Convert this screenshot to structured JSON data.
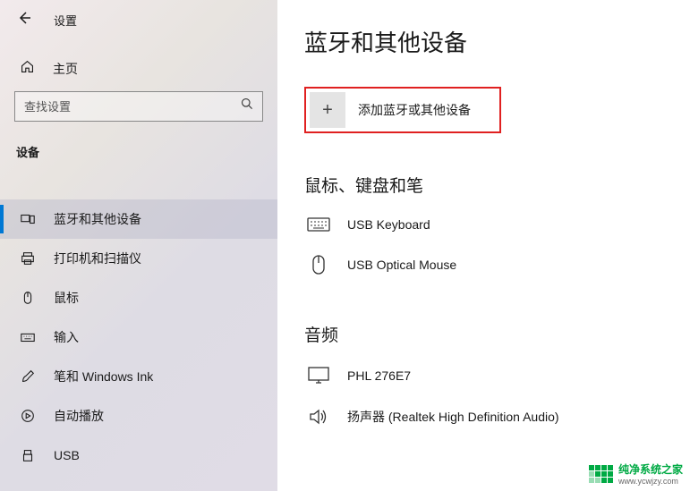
{
  "header": {
    "title": "设置"
  },
  "home": {
    "label": "主页"
  },
  "search": {
    "placeholder": "查找设置"
  },
  "category": {
    "title": "设备"
  },
  "nav": {
    "items": [
      {
        "label": "蓝牙和其他设备"
      },
      {
        "label": "打印机和扫描仪"
      },
      {
        "label": "鼠标"
      },
      {
        "label": "输入"
      },
      {
        "label": "笔和 Windows Ink"
      },
      {
        "label": "自动播放"
      },
      {
        "label": "USB"
      }
    ]
  },
  "page": {
    "title": "蓝牙和其他设备"
  },
  "add_device": {
    "label": "添加蓝牙或其他设备"
  },
  "sections": {
    "input_devices": {
      "title": "鼠标、键盘和笔"
    },
    "audio": {
      "title": "音频"
    }
  },
  "devices": {
    "keyboard": "USB Keyboard",
    "mouse": "USB Optical Mouse",
    "monitor": "PHL 276E7",
    "speaker": "扬声器 (Realtek High Definition Audio)"
  },
  "watermark": {
    "text": "纯净系统之家",
    "url": "www.ycwjzy.com"
  }
}
